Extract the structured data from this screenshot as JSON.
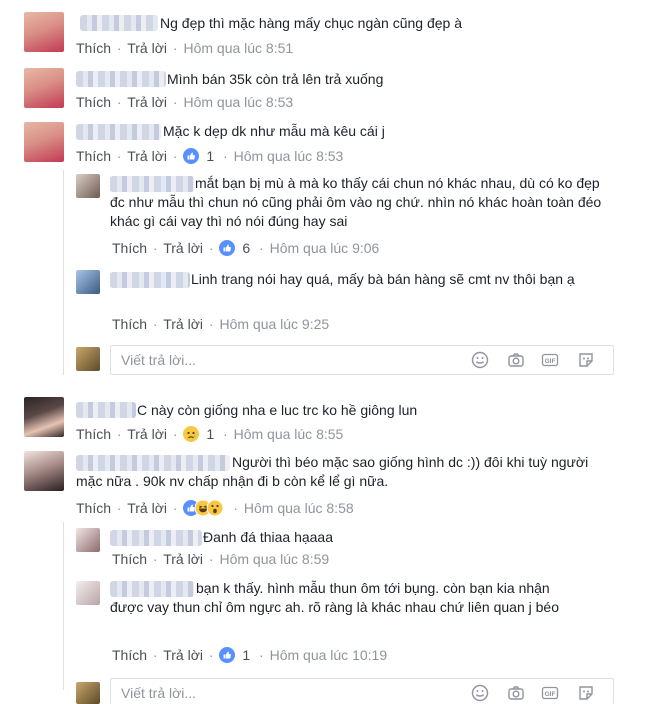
{
  "actions": {
    "like": "Thích",
    "reply": "Trả lời",
    "sep": "·"
  },
  "reply_placeholder": "Viết trả lời...",
  "comments": [
    {
      "text": "Ng đẹp thì mặc hàng mấy chục ngàn cũng đẹp à",
      "time": "Hôm qua lúc 8:51"
    },
    {
      "text": "Mình bán 35k còn trả lên trả xuống",
      "time": "Hôm qua lúc 8:53"
    },
    {
      "text": "Mặc k dẹp dk như mẫu mà kêu cái j",
      "time": "Hôm qua lúc 8:53",
      "reactions": "1"
    },
    {
      "text": "mắt bạn bị mù à mà ko thấy cái chun nó khác nhau, dù có ko đẹp đc như mẫu thì chun nó cũng phải ôm vào ng chứ. nhìn nó khác hoàn toàn đéo khác gì cái vay thì nó nói đúng hay sai",
      "time": "Hôm qua lúc 9:06",
      "reactions": "6"
    },
    {
      "text": "Linh trang nói hay quá, mấy bà bán hàng sẽ cmt nv thôi bạn ạ",
      "time": "Hôm qua lúc 9:25"
    },
    {
      "text": "C này còn giống nha e luc trc ko hề giông lun",
      "time": "Hôm qua lúc 8:55",
      "reactions": "1"
    },
    {
      "text": "Người thì béo mặc sao giống hình dc :)) đôi khi tuỳ người mặc nữa . 90k nv chấp nhận đi b còn kể lể gì nữa.",
      "time": "Hôm qua lúc 8:58"
    },
    {
      "text": "Đanh đá thiaa hạaaa",
      "time": "Hôm qua lúc 8:59"
    },
    {
      "text": "bạn k thấy. hình mẫu thun ôm tới bụng. còn bạn kia nhận được vay thun chỉ ôm ngực ah. rõ ràng là khác nhau chứ liên quan j béo",
      "time": "Hôm qua lúc 10:19",
      "reactions": "1"
    }
  ]
}
